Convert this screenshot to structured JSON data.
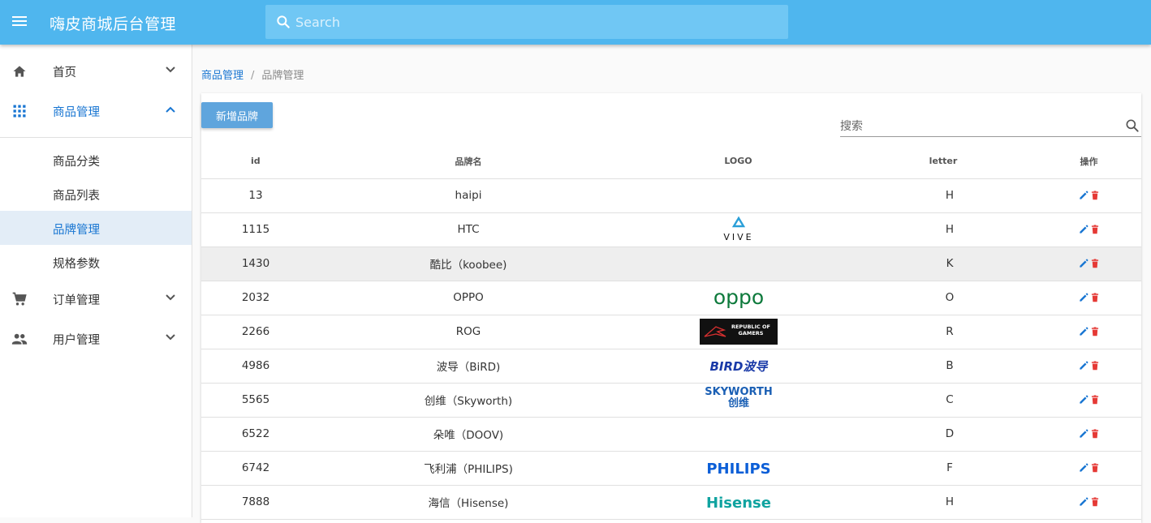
{
  "app": {
    "title": "嗨皮商城后台管理",
    "search_placeholder": "Search"
  },
  "colors": {
    "primary": "#4fb6ee",
    "link": "#1976d2",
    "button": "#5fa5dd",
    "delete": "#e53935"
  },
  "sidebar": {
    "groups": [
      {
        "label": "首页",
        "icon": "home-icon",
        "expanded": false
      },
      {
        "label": "商品管理",
        "icon": "apps-grid-icon",
        "expanded": true,
        "children": [
          {
            "label": "商品分类"
          },
          {
            "label": "商品列表"
          },
          {
            "label": "品牌管理",
            "selected": true
          },
          {
            "label": "规格参数"
          }
        ]
      },
      {
        "label": "订单管理",
        "icon": "cart-icon",
        "expanded": false
      },
      {
        "label": "用户管理",
        "icon": "people-icon",
        "expanded": false
      }
    ]
  },
  "breadcrumb": {
    "parent": "商品管理",
    "separator": "/",
    "current": "品牌管理"
  },
  "toolbar": {
    "add_label": "新增品牌",
    "search_placeholder": "搜索"
  },
  "table": {
    "headers": {
      "id": "id",
      "name": "品牌名",
      "logo": "LOGO",
      "letter": "letter",
      "ops": "操作"
    },
    "rows": [
      {
        "id": "13",
        "name": "haipi",
        "logo": "",
        "letter": "H"
      },
      {
        "id": "1115",
        "name": "HTC",
        "logo": "VIVE",
        "letter": "H"
      },
      {
        "id": "1430",
        "name": "酷比（koobee)",
        "logo": "",
        "letter": "K"
      },
      {
        "id": "2032",
        "name": "OPPO",
        "logo": "oppo",
        "letter": "O"
      },
      {
        "id": "2266",
        "name": "ROG",
        "logo": "REPUBLIC OF GAMERS",
        "letter": "R"
      },
      {
        "id": "4986",
        "name": "波导（BiRD)",
        "logo": "BIRD波导",
        "letter": "B"
      },
      {
        "id": "5565",
        "name": "创维（Skyworth)",
        "logo": "SKYWORTH 创维",
        "letter": "C"
      },
      {
        "id": "6522",
        "name": "朵唯（DOOV)",
        "logo": "",
        "letter": "D"
      },
      {
        "id": "6742",
        "name": "飞利浦（PHILIPS)",
        "logo": "PHILIPS",
        "letter": "F"
      },
      {
        "id": "7888",
        "name": "海信（Hisense)",
        "logo": "Hisense",
        "letter": "H"
      }
    ]
  }
}
